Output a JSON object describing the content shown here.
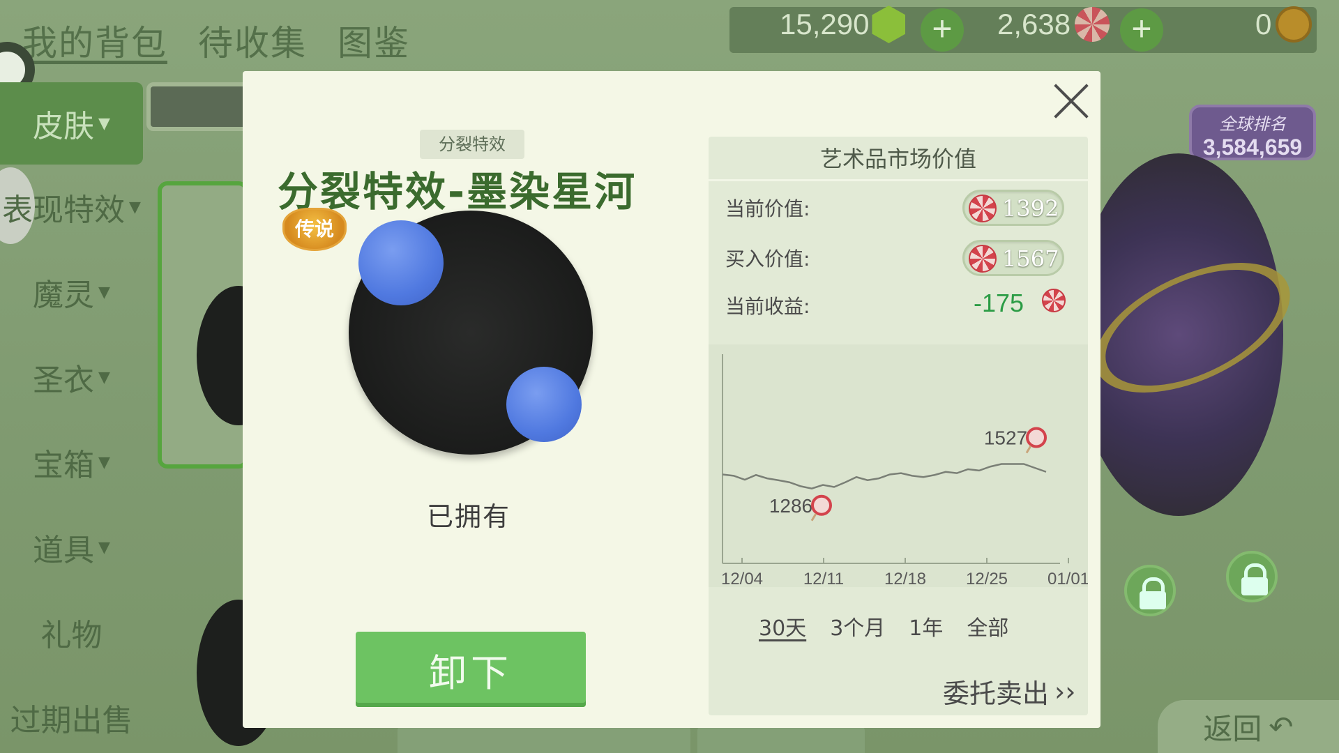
{
  "top_nav": {
    "tabs": [
      "我的背包",
      "待收集",
      "图鉴"
    ],
    "active_index": 0
  },
  "currencies": {
    "gems": "15,290",
    "candy": "2,638",
    "coins": "0",
    "add_symbol": "+"
  },
  "sidebar": {
    "items": [
      {
        "label": "皮肤",
        "caret": "▼"
      },
      {
        "label": "表现特效",
        "caret": "▼"
      },
      {
        "label": "魔灵",
        "caret": "▼"
      },
      {
        "label": "圣衣",
        "caret": "▼"
      },
      {
        "label": "宝箱",
        "caret": "▼"
      },
      {
        "label": "道具",
        "caret": "▼"
      },
      {
        "label": "礼物",
        "caret": ""
      },
      {
        "label": "过期出售",
        "caret": ""
      }
    ],
    "active_index": 0
  },
  "ranking": {
    "title": "全球排名",
    "value": "3,584,659"
  },
  "back_label": "返回",
  "modal": {
    "type_tag": "分裂特效",
    "title": "分裂特效-墨染星河",
    "rarity_badge": "传说",
    "owned_status": "已拥有",
    "unequip_label": "卸下",
    "market": {
      "title": "艺术品市场价值",
      "current_value_label": "当前价值:",
      "current_value": "1392",
      "buy_value_label": "买入价值:",
      "buy_value": "1567",
      "profit_label": "当前收益:",
      "profit": "-175"
    },
    "range_tabs": [
      "30天",
      "3个月",
      "1年",
      "全部"
    ],
    "active_range_index": 0,
    "consign_label": "委托卖出",
    "consign_arrow": "››"
  },
  "chart_data": {
    "type": "line",
    "x_ticks": [
      "12/04",
      "12/11",
      "12/18",
      "12/25",
      "01/01"
    ],
    "values": [
      1340,
      1335,
      1320,
      1338,
      1325,
      1318,
      1310,
      1295,
      1286,
      1300,
      1292,
      1310,
      1330,
      1318,
      1325,
      1340,
      1345,
      1335,
      1330,
      1338,
      1350,
      1345,
      1360,
      1355,
      1370,
      1380,
      1527,
      1380,
      1365,
      1350
    ],
    "annotations": [
      {
        "label": "1286",
        "index": 8
      },
      {
        "label": "1527",
        "index": 26
      }
    ],
    "ylim": [
      1000,
      1800
    ]
  },
  "colors": {
    "accent_green": "#6dc362",
    "title_green": "#3b6b2e",
    "profit_green": "#2b9c45"
  }
}
